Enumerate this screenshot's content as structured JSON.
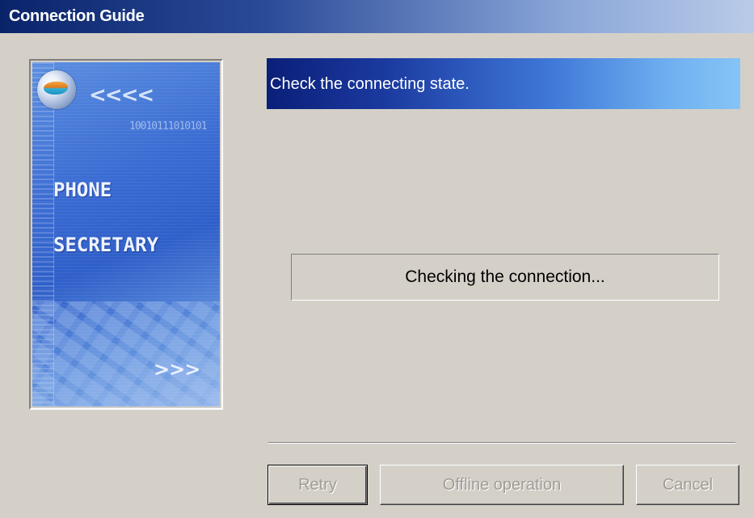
{
  "window": {
    "title": "Connection Guide"
  },
  "banner": {
    "line1": "PHONE",
    "line2": "SECRETARY",
    "binary_text": "10010111010101",
    "arrows_left": "<<<<",
    "arrows_right": ">>>"
  },
  "header": {
    "text": "Check the connecting state."
  },
  "status": {
    "text": "Checking the connection..."
  },
  "buttons": {
    "retry": "Retry",
    "offline": "Offline operation",
    "cancel": "Cancel"
  },
  "colors": {
    "dialog_bg": "#d4d0c8",
    "title_gradient_start": "#0a246a",
    "header_gradient_start": "#0a1f78",
    "header_gradient_end": "#86c4f6",
    "disabled_text": "#a09c94"
  }
}
